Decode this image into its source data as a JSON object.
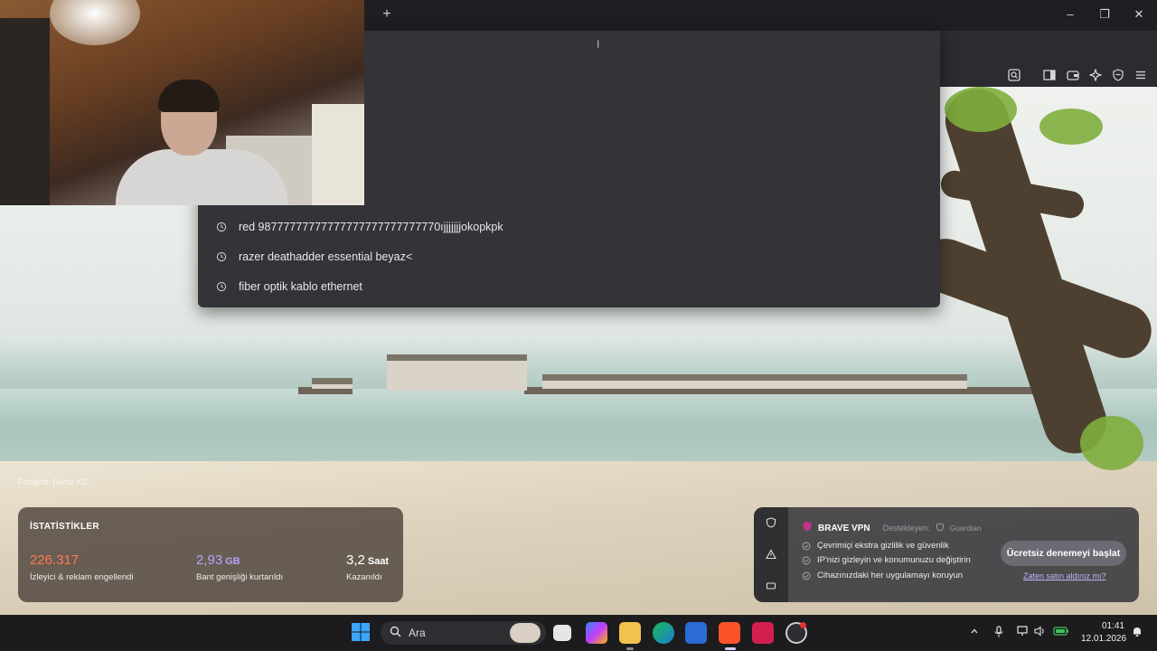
{
  "browser": {
    "new_tab_symbol": "+",
    "window_controls": {
      "minimize": "–",
      "maximize": "❐",
      "close": "✕"
    }
  },
  "omnibox": {
    "suggestions": [
      {
        "text": "red 98777777777777777777777777770ıjjjjjjjokopkpk",
        "icon": "history-icon"
      },
      {
        "text": "razer deathadder essential beyaz<",
        "icon": "history-icon"
      },
      {
        "text": "fiber optik kablo ethernet",
        "icon": "history-icon"
      }
    ]
  },
  "wallpaper": {
    "credit": "Fotoğraf: Rahul KC"
  },
  "stats": {
    "title": "İSTATİSTİKLER",
    "items": [
      {
        "value": "226.317",
        "unit": "",
        "label": "İzleyici & reklam engellendi",
        "color": "#ff7a52"
      },
      {
        "value": "2,93",
        "unit": "GB",
        "label": "Bant genişliği kurtarıldı",
        "color": "#b5a4ff"
      },
      {
        "value": "3,2",
        "unit": "Saat",
        "label": "Kazanıldı",
        "color": "#ffffff"
      }
    ]
  },
  "vpn": {
    "title": "BRAVE VPN",
    "sponsor_label": "Destekleyen:",
    "sponsor_brand": "Guardian",
    "features": [
      "Çevrimiçi ekstra gizlilik ve güvenlik",
      "IP'nizi gizleyin ve konumunuzu değiştirin",
      "Cihazınızdaki her uygulamayı koruyun"
    ],
    "cta": "Ücretsiz denemeyi başlat",
    "link": "Zaten satın aldınız mı?"
  },
  "taskbar": {
    "search_placeholder": "Ara",
    "time": "01:41",
    "date": "12.01.2026"
  }
}
